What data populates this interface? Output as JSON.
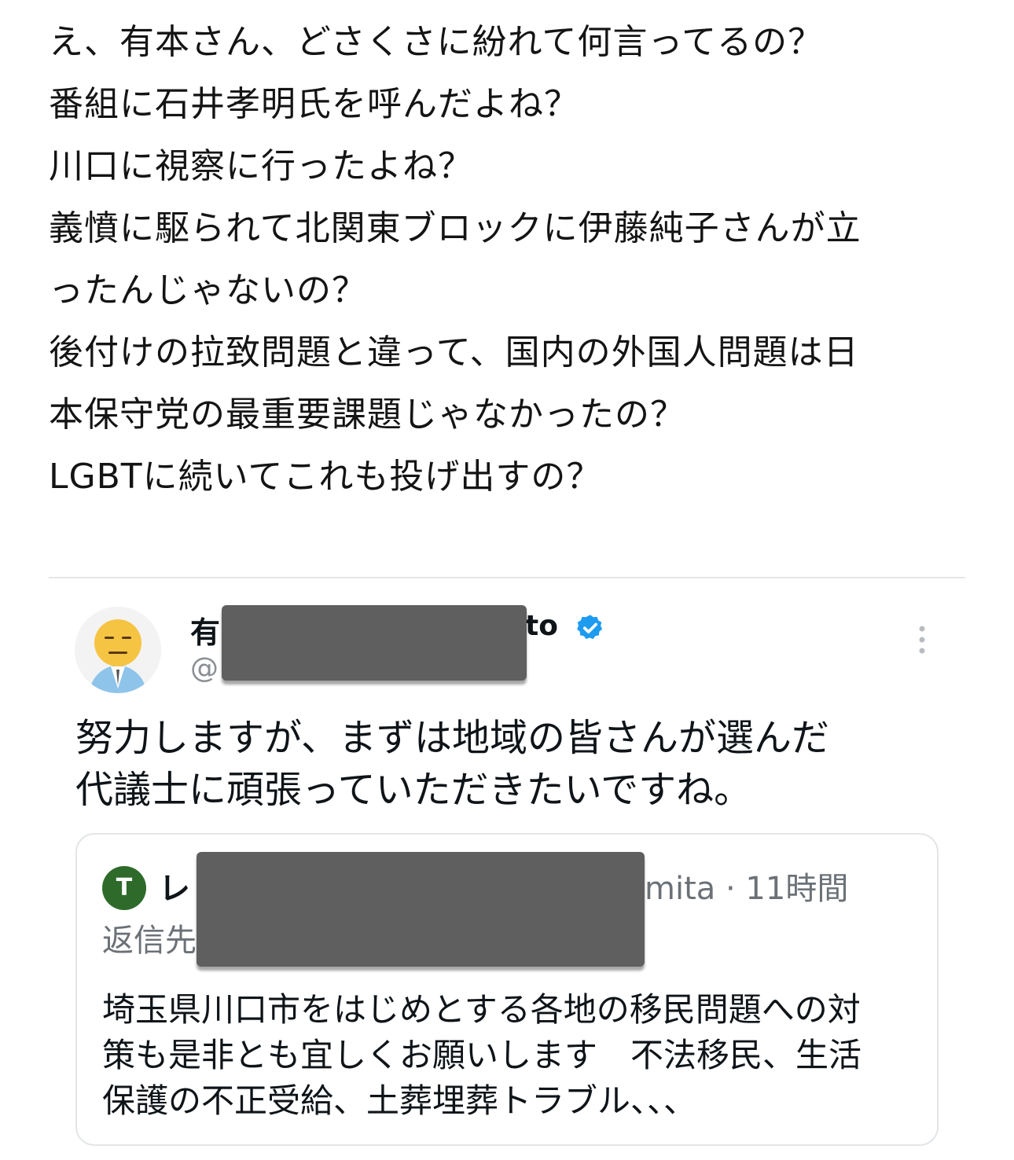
{
  "post": {
    "lines": [
      "え、有本さん、どさくさに紛れて何言ってるの？",
      "番組に石井孝明氏を呼んだよね？",
      "川口に視察に行ったよね？",
      "義憤に駆られて北関東ブロックに伊藤純子さんが立",
      "ったんじゃないの？",
      "後付けの拉致問題と違って、国内の外国人問題は日",
      "本保守党の最重要課題じゃなかったの？",
      "LGBTに続いてこれも投げ出すの？"
    ]
  },
  "embedded_tweet": {
    "author_name_visible_start": "有",
    "author_name_visible_end": "to",
    "handle_visible_start": "@",
    "verified_icon": "verified-badge-icon",
    "more_icon": "more-vertical-icon",
    "avatar_icon": "avatar-icon",
    "body_lines": [
      "努力しますが、まずは地域の皆さんが選んだ",
      "代議士に頑張っていただきたいですね。"
    ],
    "quoted_tweet": {
      "avatar_letter": "T",
      "author_name_visible_start": "レ",
      "meta_visible": "mita · 11時間",
      "reply_to_visible_start": "返信先",
      "body_lines": [
        "埼玉県川口市をはじめとする各地の移民問題への対",
        "策も是非とも宜しくお願いします　不法移民、生活",
        "保護の不正受給、土葬埋葬トラブル、、、"
      ]
    }
  },
  "colors": {
    "text": "#141414",
    "muted": "#6b7177",
    "verified_blue": "#1d9bf0",
    "redaction": "#5f5f5f",
    "quoted_avatar": "#2e6b2a"
  }
}
